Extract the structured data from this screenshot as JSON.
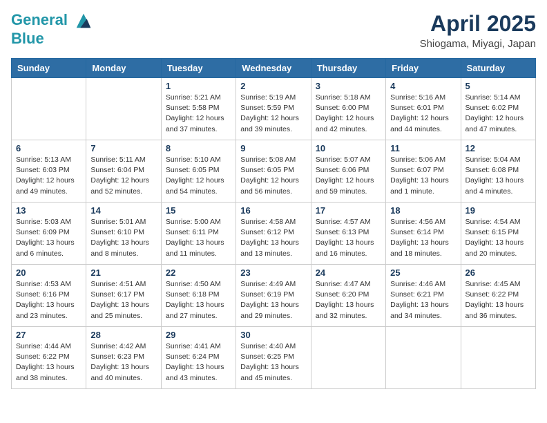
{
  "header": {
    "logo_line1": "General",
    "logo_line2": "Blue",
    "month": "April 2025",
    "location": "Shiogama, Miyagi, Japan"
  },
  "weekdays": [
    "Sunday",
    "Monday",
    "Tuesday",
    "Wednesday",
    "Thursday",
    "Friday",
    "Saturday"
  ],
  "weeks": [
    [
      {
        "day": "",
        "info": ""
      },
      {
        "day": "",
        "info": ""
      },
      {
        "day": "1",
        "info": "Sunrise: 5:21 AM\nSunset: 5:58 PM\nDaylight: 12 hours\nand 37 minutes."
      },
      {
        "day": "2",
        "info": "Sunrise: 5:19 AM\nSunset: 5:59 PM\nDaylight: 12 hours\nand 39 minutes."
      },
      {
        "day": "3",
        "info": "Sunrise: 5:18 AM\nSunset: 6:00 PM\nDaylight: 12 hours\nand 42 minutes."
      },
      {
        "day": "4",
        "info": "Sunrise: 5:16 AM\nSunset: 6:01 PM\nDaylight: 12 hours\nand 44 minutes."
      },
      {
        "day": "5",
        "info": "Sunrise: 5:14 AM\nSunset: 6:02 PM\nDaylight: 12 hours\nand 47 minutes."
      }
    ],
    [
      {
        "day": "6",
        "info": "Sunrise: 5:13 AM\nSunset: 6:03 PM\nDaylight: 12 hours\nand 49 minutes."
      },
      {
        "day": "7",
        "info": "Sunrise: 5:11 AM\nSunset: 6:04 PM\nDaylight: 12 hours\nand 52 minutes."
      },
      {
        "day": "8",
        "info": "Sunrise: 5:10 AM\nSunset: 6:05 PM\nDaylight: 12 hours\nand 54 minutes."
      },
      {
        "day": "9",
        "info": "Sunrise: 5:08 AM\nSunset: 6:05 PM\nDaylight: 12 hours\nand 56 minutes."
      },
      {
        "day": "10",
        "info": "Sunrise: 5:07 AM\nSunset: 6:06 PM\nDaylight: 12 hours\nand 59 minutes."
      },
      {
        "day": "11",
        "info": "Sunrise: 5:06 AM\nSunset: 6:07 PM\nDaylight: 13 hours\nand 1 minute."
      },
      {
        "day": "12",
        "info": "Sunrise: 5:04 AM\nSunset: 6:08 PM\nDaylight: 13 hours\nand 4 minutes."
      }
    ],
    [
      {
        "day": "13",
        "info": "Sunrise: 5:03 AM\nSunset: 6:09 PM\nDaylight: 13 hours\nand 6 minutes."
      },
      {
        "day": "14",
        "info": "Sunrise: 5:01 AM\nSunset: 6:10 PM\nDaylight: 13 hours\nand 8 minutes."
      },
      {
        "day": "15",
        "info": "Sunrise: 5:00 AM\nSunset: 6:11 PM\nDaylight: 13 hours\nand 11 minutes."
      },
      {
        "day": "16",
        "info": "Sunrise: 4:58 AM\nSunset: 6:12 PM\nDaylight: 13 hours\nand 13 minutes."
      },
      {
        "day": "17",
        "info": "Sunrise: 4:57 AM\nSunset: 6:13 PM\nDaylight: 13 hours\nand 16 minutes."
      },
      {
        "day": "18",
        "info": "Sunrise: 4:56 AM\nSunset: 6:14 PM\nDaylight: 13 hours\nand 18 minutes."
      },
      {
        "day": "19",
        "info": "Sunrise: 4:54 AM\nSunset: 6:15 PM\nDaylight: 13 hours\nand 20 minutes."
      }
    ],
    [
      {
        "day": "20",
        "info": "Sunrise: 4:53 AM\nSunset: 6:16 PM\nDaylight: 13 hours\nand 23 minutes."
      },
      {
        "day": "21",
        "info": "Sunrise: 4:51 AM\nSunset: 6:17 PM\nDaylight: 13 hours\nand 25 minutes."
      },
      {
        "day": "22",
        "info": "Sunrise: 4:50 AM\nSunset: 6:18 PM\nDaylight: 13 hours\nand 27 minutes."
      },
      {
        "day": "23",
        "info": "Sunrise: 4:49 AM\nSunset: 6:19 PM\nDaylight: 13 hours\nand 29 minutes."
      },
      {
        "day": "24",
        "info": "Sunrise: 4:47 AM\nSunset: 6:20 PM\nDaylight: 13 hours\nand 32 minutes."
      },
      {
        "day": "25",
        "info": "Sunrise: 4:46 AM\nSunset: 6:21 PM\nDaylight: 13 hours\nand 34 minutes."
      },
      {
        "day": "26",
        "info": "Sunrise: 4:45 AM\nSunset: 6:22 PM\nDaylight: 13 hours\nand 36 minutes."
      }
    ],
    [
      {
        "day": "27",
        "info": "Sunrise: 4:44 AM\nSunset: 6:22 PM\nDaylight: 13 hours\nand 38 minutes."
      },
      {
        "day": "28",
        "info": "Sunrise: 4:42 AM\nSunset: 6:23 PM\nDaylight: 13 hours\nand 40 minutes."
      },
      {
        "day": "29",
        "info": "Sunrise: 4:41 AM\nSunset: 6:24 PM\nDaylight: 13 hours\nand 43 minutes."
      },
      {
        "day": "30",
        "info": "Sunrise: 4:40 AM\nSunset: 6:25 PM\nDaylight: 13 hours\nand 45 minutes."
      },
      {
        "day": "",
        "info": ""
      },
      {
        "day": "",
        "info": ""
      },
      {
        "day": "",
        "info": ""
      }
    ]
  ]
}
